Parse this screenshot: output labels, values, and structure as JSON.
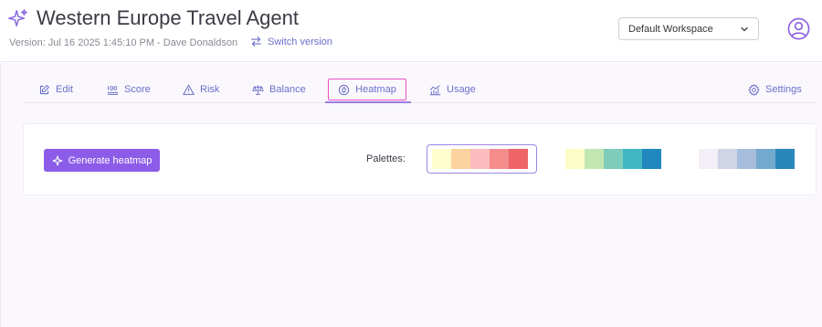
{
  "header": {
    "title": "Western Europe Travel Agent",
    "version": "Version: Jul 16 2025 1:45:10 PM - Dave Donaldson",
    "switch_label": "Switch version",
    "workspace": "Default Workspace",
    "icons": {
      "title": "sparkle-icon",
      "switch": "swap-arrows-icon",
      "workspace": "chevron-down-icon",
      "avatar": "user-icon"
    }
  },
  "tabs": [
    {
      "label": "Edit",
      "icon": "edit-icon"
    },
    {
      "label": "Score",
      "icon": "score-100-icon"
    },
    {
      "label": "Risk",
      "icon": "warning-icon"
    },
    {
      "label": "Balance",
      "icon": "balance-scale-icon"
    },
    {
      "label": "Heatmap",
      "icon": "heatmap-icon",
      "active": true
    },
    {
      "label": "Usage",
      "icon": "usage-chart-icon"
    },
    {
      "label": "Settings",
      "icon": "gear-icon"
    }
  ],
  "heatmap": {
    "generate_label": "Generate heatmap",
    "palettes_label": "Palettes:",
    "selected_palette": 0,
    "palettes": [
      [
        "#fefecd",
        "#fdd2a1",
        "#fbbcbd",
        "#f48d8c",
        "#ee6467"
      ],
      [
        "#fcfdc6",
        "#c2e6b2",
        "#7ecdbb",
        "#42b7c4",
        "#2188bf"
      ],
      [
        "#f4eef6",
        "#d1d3e7",
        "#a6bddb",
        "#73a9cf",
        "#2b86bc"
      ]
    ]
  },
  "colors": {
    "accent": "#8c5ce8",
    "link": "#6b6fc9",
    "highlight": "#ec4ec6",
    "background": "#faf8fd"
  }
}
